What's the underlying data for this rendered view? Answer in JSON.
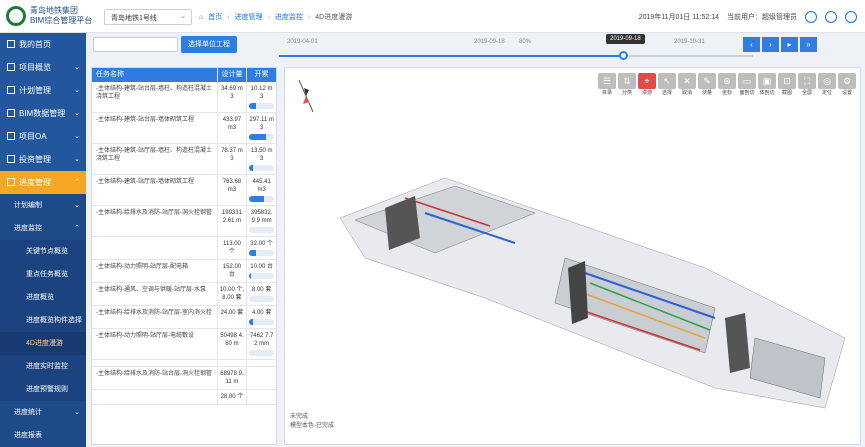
{
  "header": {
    "org_name": "青岛地铁集团",
    "platform_name": "BIM综合管理平台",
    "line_select": "青岛地铁1号线",
    "breadcrumbs": [
      "首页",
      "进度管理",
      "进度监控",
      "4D进度漫游"
    ],
    "datetime": "2019年11月01日 11:52:14",
    "user_label": "当前用户：",
    "user_name": "超级管理员"
  },
  "sidebar": {
    "items": [
      {
        "label": "我的首页",
        "icon": "home-icon"
      },
      {
        "label": "项目概览",
        "icon": "grid-icon"
      },
      {
        "label": "计划管理",
        "icon": "calendar-icon"
      },
      {
        "label": "BIM数据管理",
        "icon": "database-icon"
      },
      {
        "label": "项目OA",
        "icon": "doc-icon"
      },
      {
        "label": "投资管理",
        "icon": "chart-icon"
      },
      {
        "label": "进度管理",
        "icon": "progress-icon"
      }
    ],
    "sub": [
      "计划编制",
      "进度监控"
    ],
    "sub2": [
      "关键节点概览",
      "重点任务概览",
      "进度概览",
      "进度概览构件选择",
      "4D进度漫游",
      "进度实时监控",
      "进度预警规则"
    ],
    "bottom": [
      "进度统计",
      "进度报表"
    ]
  },
  "toolbar": {
    "select_unit_button": "选择单位工程"
  },
  "timeline": {
    "start": "2019-04-01",
    "mid_label": "2019-09-18",
    "mid_pct": "80%",
    "end": "2019-10-31",
    "current": "2019-09-18",
    "progress_fraction": 0.8
  },
  "table": {
    "headers": [
      "任务名称",
      "设计量",
      "开累"
    ],
    "rows": [
      {
        "name": "-主体结构-建筑-站台层-墙柱、构造柱混凝土浇筑工程",
        "design": "34.69 m3",
        "cum": "10.12 m3",
        "pct": 0.29
      },
      {
        "name": "-主体结构-建筑-站台层-墙体砌筑工程",
        "design": "433.97 m3",
        "cum": "297.11 m3",
        "pct": 0.68
      },
      {
        "name": "-主体结构-建筑-站厅层-墙柱、构造柱混凝土浇筑工程",
        "design": "78.37 m3",
        "cum": "13.50 m3",
        "pct": 0.17
      },
      {
        "name": "-主体结构-建筑-站厅层-墙体砌筑工程",
        "design": "763.68 m3",
        "cum": "445.41 m3",
        "pct": 0.58
      },
      {
        "name": "-主体结构-给排水及消防-站厅层-洞火栓钢管",
        "design": "199331 2.61 m",
        "cum": "395832.9 9 mm",
        "pct": 0
      },
      {
        "name": "",
        "design": "113.00 个",
        "cum": "32.00 个",
        "pct": 0.28
      },
      {
        "name": "-主体结构-动力照明-站厅层-配电箱",
        "design": "152.00 台",
        "cum": "10.00 台",
        "pct": 0.07
      },
      {
        "name": "-主体结构-通风、空调与供暖-站厅层-水泵",
        "design": "10.00 个, 8.00 套",
        "cum": "8.00 套",
        "pct": 0
      },
      {
        "name": "-主体结构-给排水及消防-站厅层-室内消火栓",
        "design": "24.00 套",
        "cum": "4.00 套",
        "pct": 0.17
      },
      {
        "name": "-主体结构-动力照明-站厅层-电缆敷设",
        "design": "50498 4.60 m",
        "cum": "7462 7.72 mm",
        "pct": 0
      },
      {
        "name": "",
        "design": "",
        "cum": "",
        "pct": 0
      },
      {
        "name": "-主体结构-给排水及消防-站台层-洞火栓钢管",
        "design": "68978 9.11 m",
        "cum": "",
        "pct": 0
      },
      {
        "name": "",
        "design": "28.00 个",
        "cum": "",
        "pct": 0
      }
    ]
  },
  "viewer": {
    "tools": [
      "目录",
      "分类",
      "漫游",
      "选择",
      "取消",
      "测量",
      "坐标",
      "面剖切",
      "体剖切",
      "截图",
      "全屏",
      "定位",
      "设置"
    ],
    "legend_1": "未完成",
    "legend_2": "模型本色-已完成"
  },
  "colors": {
    "primary": "#2f7de1",
    "sidebar": "#22579e",
    "active": "#f5a623"
  }
}
